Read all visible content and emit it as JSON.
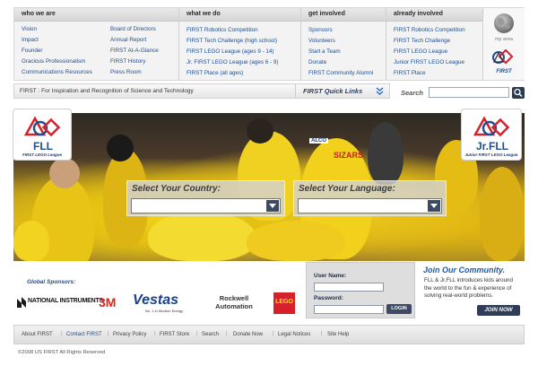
{
  "nav": {
    "columns": [
      {
        "heading": "who we are",
        "left": [
          "Vision",
          "Impact",
          "Founder",
          "Gracious Professionalism",
          "Communications Resources"
        ],
        "right": [
          "Board of Directors",
          "Annual Report",
          "FIRST At-A-Glance",
          "FIRST History",
          "Press Room"
        ]
      },
      {
        "heading": "what we do",
        "items": [
          "FIRST Robotics Competition",
          "FIRST Tech Challenge (high school)",
          "FIRST LEGO League (ages 9 - 14)",
          "Jr. FIRST LEGO League (ages 6 - 9)",
          "FIRST Place (all ages)"
        ]
      },
      {
        "heading": "get involved",
        "items": [
          "Sponsors",
          "Volunteers",
          "Start a Team",
          "Donate",
          "FIRST Community Alumni"
        ]
      },
      {
        "heading": "already involved",
        "items": [
          "FIRST Robotics Competition",
          "FIRST Tech Challenge",
          "FIRST LEGO League",
          "Junior FIRST LEGO League",
          "FIRST Place"
        ]
      }
    ],
    "my_area": {
      "label": "my area",
      "icon": "globe-icon",
      "logo_text": "FIRST"
    }
  },
  "tagbar": {
    "tagline": "FIRST : For Inspiration and Recognition of Science and Technology",
    "quick_links": "FIRST Quick Links"
  },
  "search": {
    "label": "Search",
    "placeholder": "",
    "icon": "search-icon"
  },
  "hero": {
    "fll_logo": {
      "text": "FLL",
      "caption": "FIRST LEGO League"
    },
    "jrfll_logo": {
      "text": "Jr.FLL",
      "caption": "Junior FIRST LEGO League"
    },
    "country_select": {
      "label": "Select Your Country:",
      "value": ""
    },
    "language_select": {
      "label": "Select Your Language:",
      "value": ""
    },
    "shirt_text": [
      "SIZARS",
      "ALCO"
    ]
  },
  "sponsors": {
    "title": "Global Sponsors:",
    "items": [
      "NATIONAL INSTRUMENTS",
      "3M",
      "Vestas",
      "No. 1 in Modern Energy",
      "Rockwell Automation",
      "LEGO"
    ]
  },
  "login": {
    "username_label": "User Name:",
    "password_label": "Password:",
    "button": "LOGIN"
  },
  "community": {
    "title": "Join Our Community.",
    "text": "FLL & Jr.FLL introduces kids around the world to the fun & experience of solving real-world problems.",
    "button": "JOIN NOW"
  },
  "footer": {
    "links": [
      "About FIRST",
      "Contact FIRST",
      "Privacy Policy",
      "FIRST Store",
      "Search",
      "Donate Now",
      "Legal Notices",
      "Site Help"
    ],
    "copyright": "©2008 US FIRST All Rights Reserved"
  },
  "colors": {
    "link": "#1d4f91",
    "accent": "#1d5aa8",
    "brand_red": "#d6202c",
    "hero_yellow": "#e8c21a"
  }
}
